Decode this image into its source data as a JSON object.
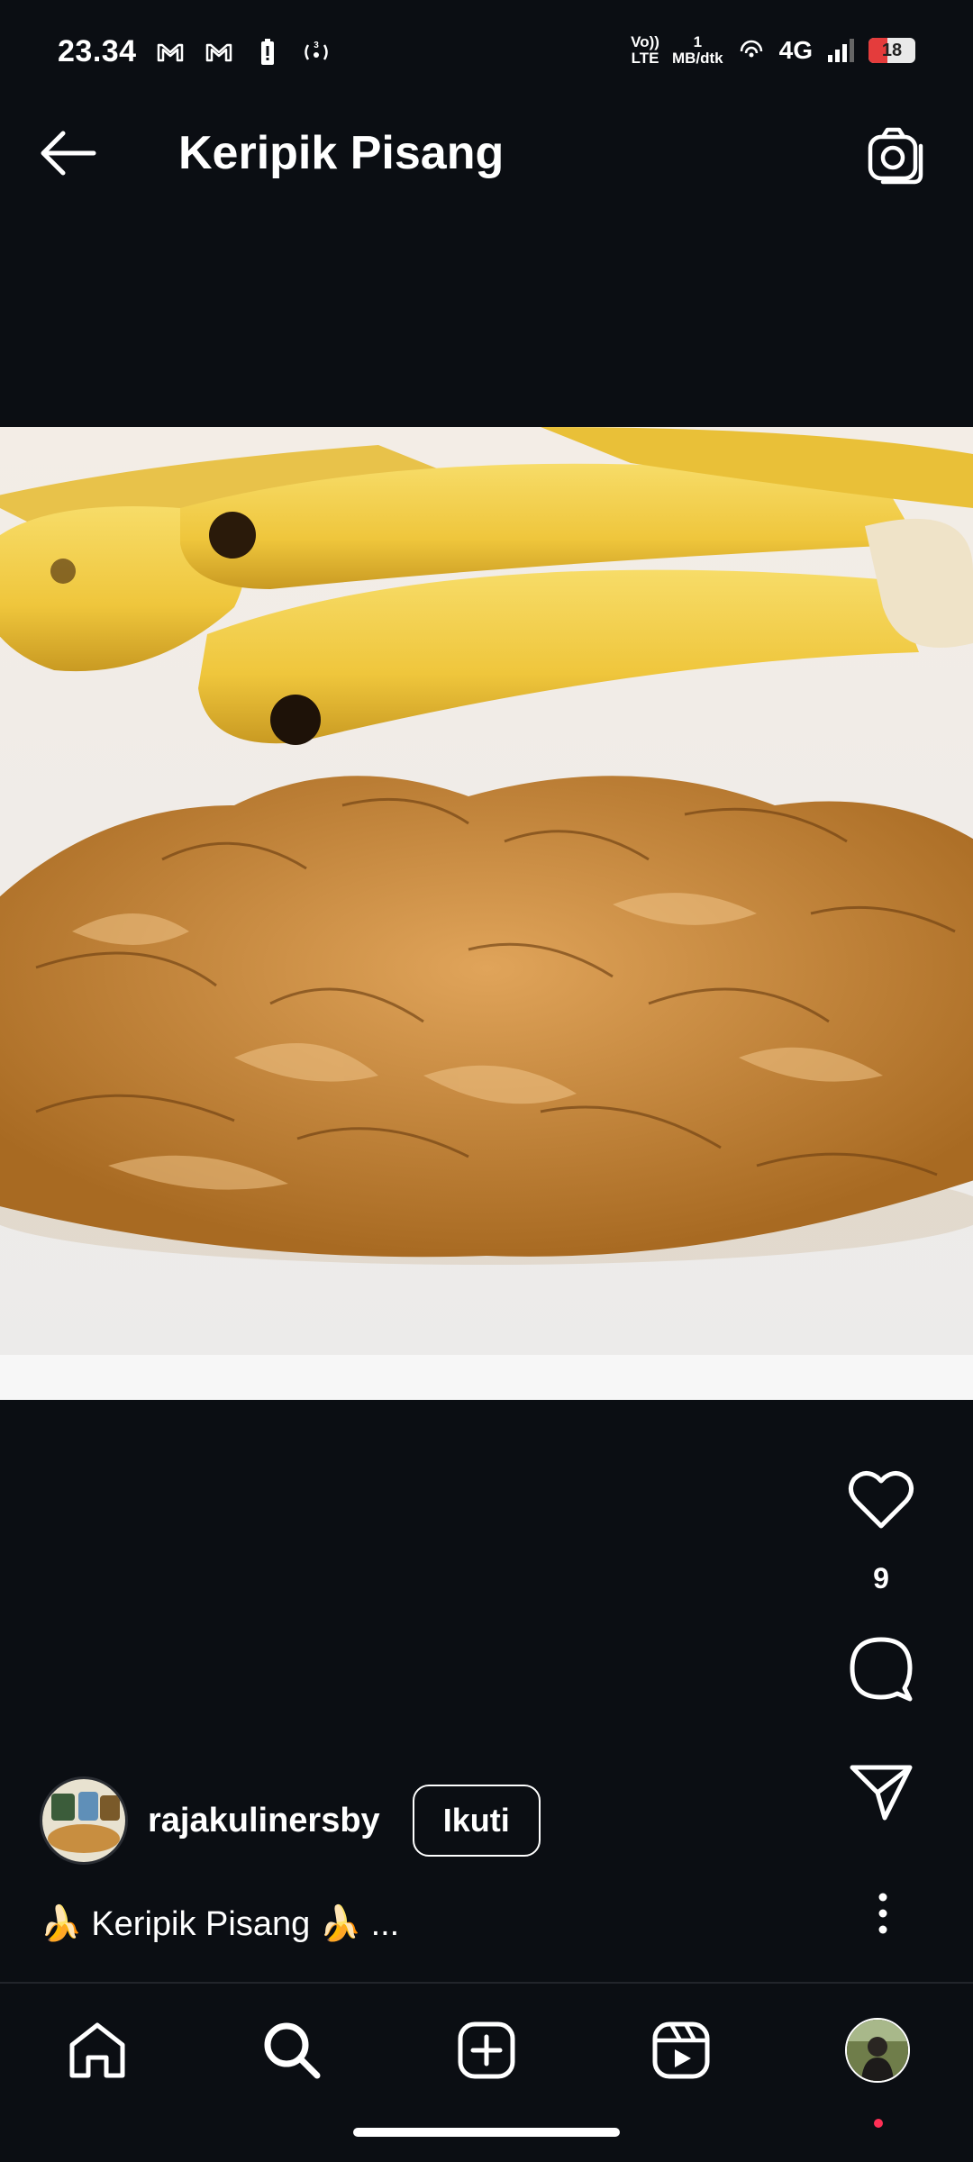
{
  "status_bar": {
    "time": "23.34",
    "network_speed_value": "1",
    "network_speed_unit": "MB/dtk",
    "volte_top": "Vo))",
    "volte_bottom": "LTE",
    "network_type": "4G",
    "battery_level": "18",
    "hotspot_count": "3"
  },
  "header": {
    "title": "Keripik Pisang"
  },
  "post": {
    "like_count": "9",
    "author": "rajakulinersby",
    "follow_label": "Ikuti",
    "caption_emoji_left": "🍌",
    "caption_text": "Keripik Pisang",
    "caption_emoji_right": "🍌",
    "caption_more": "..."
  },
  "colors": {
    "background": "#0b0e13",
    "text": "#ffffff",
    "battery_low": "#e43c3c",
    "notification_dot": "#ff2f55"
  }
}
